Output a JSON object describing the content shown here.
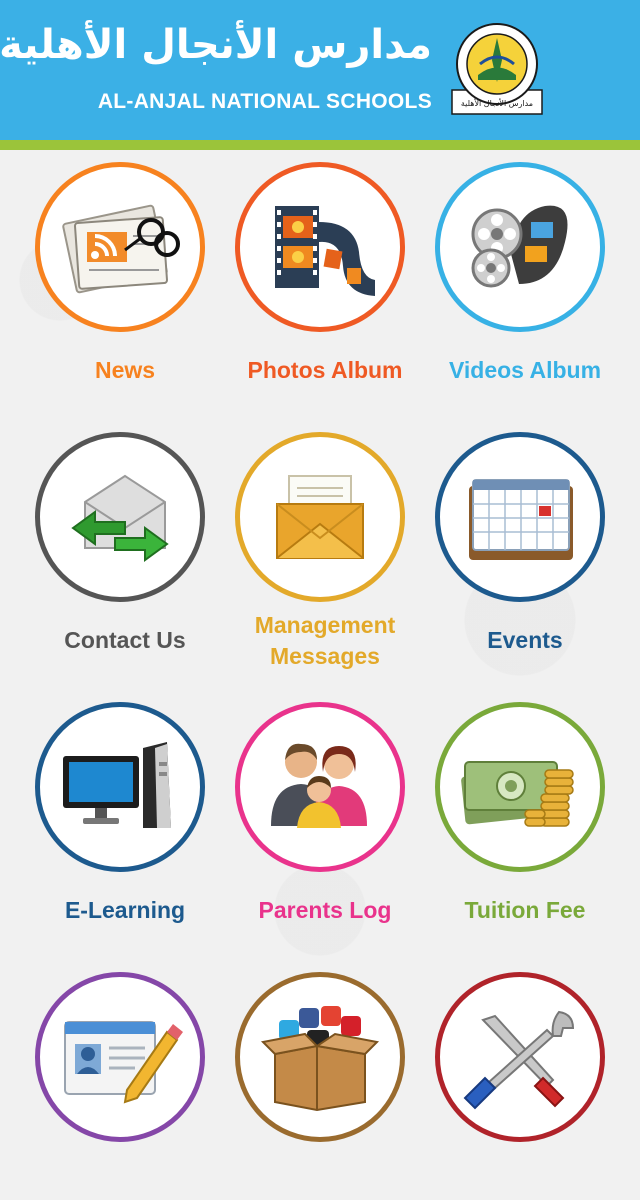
{
  "header": {
    "title_ar": "مدارس الأنجال الأهلية",
    "title_en": "AL-ANJAL NATIONAL SCHOOLS",
    "logo_text": "AL-ANJAL NATIONAL SCHOOLS",
    "logo_text_ar": "مدارس الأنجال الأهلية"
  },
  "colors": {
    "header": "#3bb0e6",
    "stripe": "#9bc43a",
    "orange": "#f7821f",
    "orange_red": "#ef5a24",
    "sky": "#37b1e5",
    "gray": "#555555",
    "gold": "#e3a92a",
    "navy": "#1d5a8e",
    "pink": "#e9338c",
    "green": "#7aa93a",
    "purple": "#8547a8",
    "brown": "#9a6b2e",
    "dark_red": "#b0232a"
  },
  "tiles": [
    {
      "label": "News",
      "icon": "newspaper-icon",
      "color": "#f7821f"
    },
    {
      "label": "Photos Album",
      "icon": "film-strip-icon",
      "color": "#ef5a24"
    },
    {
      "label": "Videos Album",
      "icon": "film-reel-icon",
      "color": "#37b1e5"
    },
    {
      "label": "Contact Us",
      "icon": "mail-arrows-icon",
      "color": "#555555"
    },
    {
      "label": "Management Messages",
      "label_line1": "Management",
      "label_line2": "Messages",
      "icon": "envelope-icon",
      "color": "#e3a92a"
    },
    {
      "label": "Events",
      "icon": "calendar-icon",
      "color": "#1d5a8e"
    },
    {
      "label": "E-Learning",
      "icon": "computer-icon",
      "color": "#1d5a8e"
    },
    {
      "label": "Parents Log",
      "icon": "family-icon",
      "color": "#e9338c"
    },
    {
      "label": "Tuition Fee",
      "icon": "money-coins-icon",
      "color": "#7aa93a"
    },
    {
      "label": "",
      "icon": "id-card-pencil-icon",
      "color": "#8547a8"
    },
    {
      "label": "",
      "icon": "social-box-icon",
      "color": "#9a6b2e"
    },
    {
      "label": "",
      "icon": "tools-icon",
      "color": "#b0232a"
    }
  ]
}
